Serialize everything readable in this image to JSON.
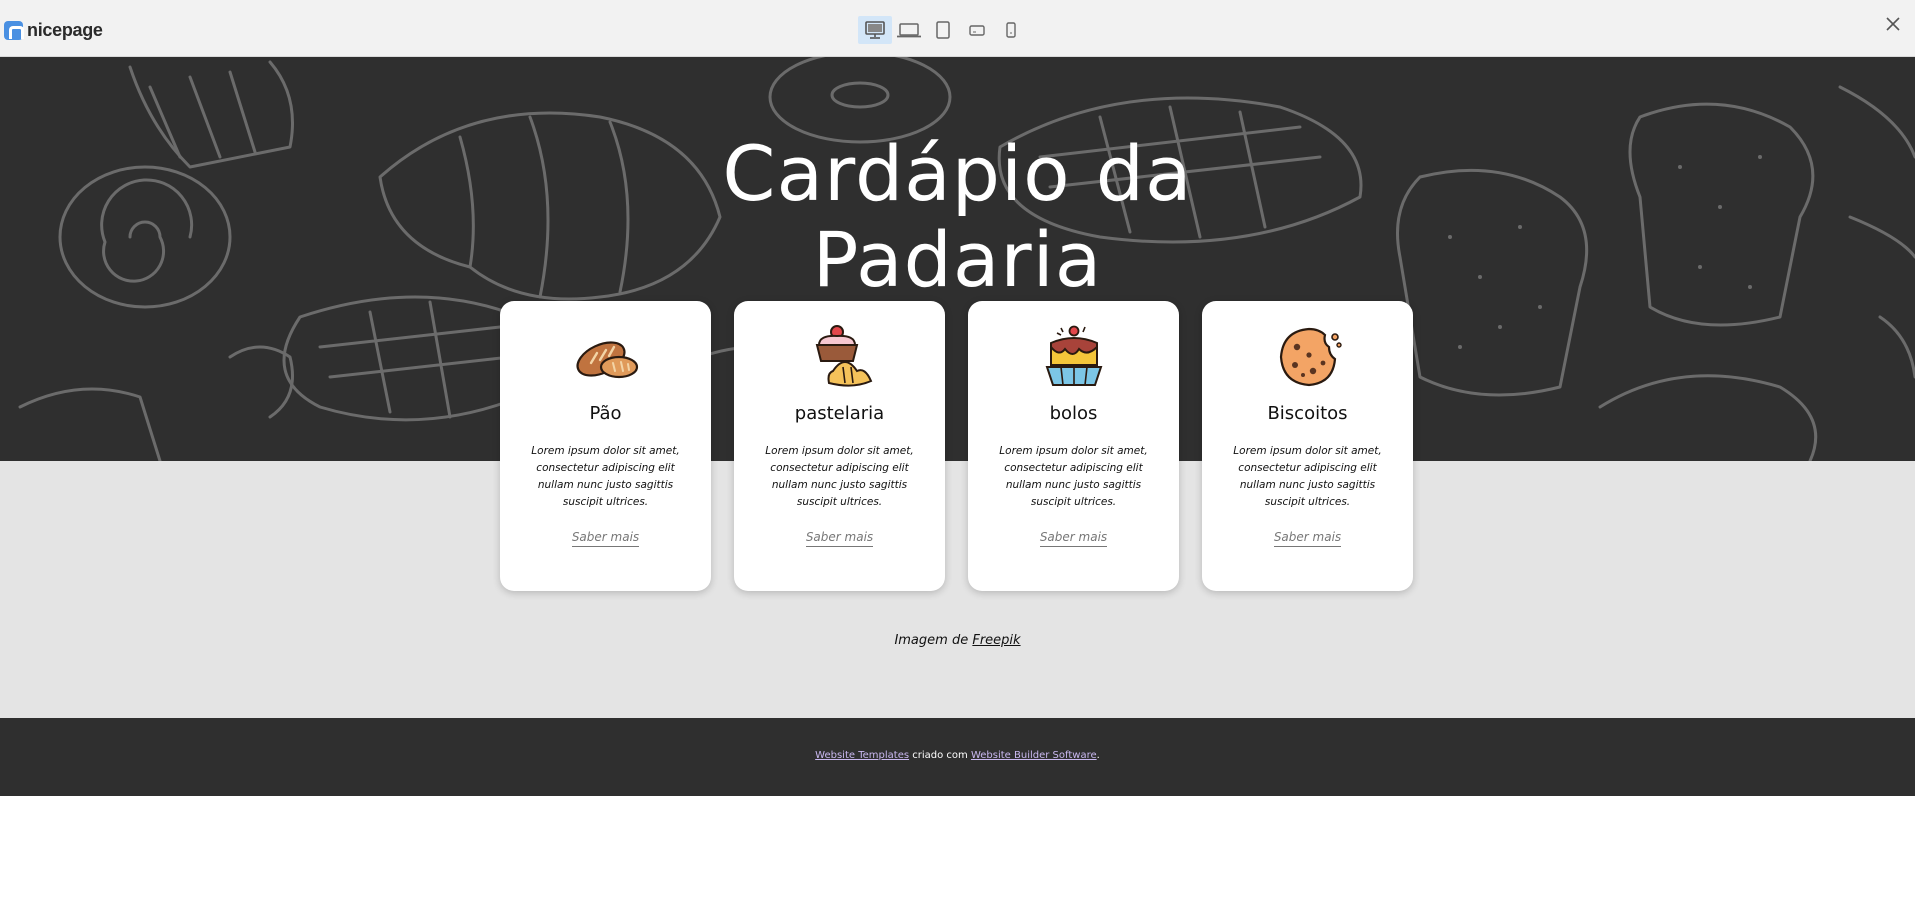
{
  "topbar": {
    "logo_text": "nicepage",
    "devices": [
      "desktop-icon",
      "laptop-icon",
      "tablet-icon",
      "phone-landscape-icon",
      "phone-portrait-icon"
    ],
    "active_device": "desktop-icon",
    "close_icon": "close-icon"
  },
  "hero": {
    "title_line1": "Cardápio da",
    "title_line2": "Padaria",
    "background_color": "#2f2f2f"
  },
  "cards": [
    {
      "icon": "bread-icon",
      "title": "Pão",
      "text": "Lorem ipsum dolor sit amet, consectetur adipiscing elit nullam nunc justo sagittis suscipit ultrices.",
      "link": "Saber mais"
    },
    {
      "icon": "pastry-icon",
      "title": "pastelaria",
      "text": "Lorem ipsum dolor sit amet, consectetur adipiscing elit nullam nunc justo sagittis suscipit ultrices.",
      "link": "Saber mais"
    },
    {
      "icon": "cake-icon",
      "title": "bolos",
      "text": "Lorem ipsum dolor sit amet, consectetur adipiscing elit nullam nunc justo sagittis suscipit ultrices.",
      "link": "Saber mais"
    },
    {
      "icon": "cookie-icon",
      "title": "Biscoitos",
      "text": "Lorem ipsum dolor sit amet, consectetur adipiscing elit nullam nunc justo sagittis suscipit ultrices.",
      "link": "Saber mais"
    }
  ],
  "credit": {
    "prefix": "Imagem de",
    "link": "Freepik"
  },
  "footer": {
    "link1": "Website Templates",
    "middle": "criado com",
    "link2": "Website Builder Software",
    "suffix": "."
  },
  "colors": {
    "accent": "#4a90e2",
    "lower_bg": "#e4e4e4",
    "footer_link": "#c9b8f0"
  }
}
